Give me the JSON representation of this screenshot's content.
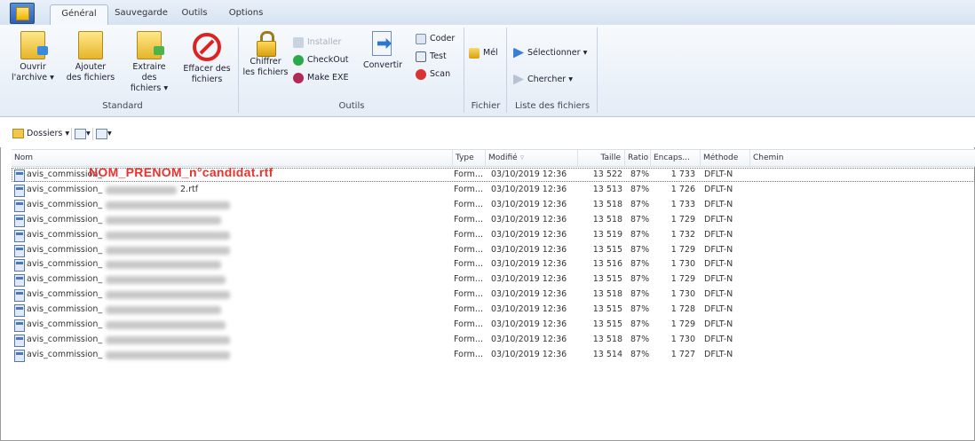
{
  "tabs": [
    "Général",
    "Sauvegarde",
    "Outils",
    "Options"
  ],
  "ribbon": {
    "standard": {
      "label": "Standard",
      "buttons": [
        {
          "line1": "Ouvrir",
          "line2": "l'archive ▾"
        },
        {
          "line1": "Ajouter",
          "line2": "des fichiers"
        },
        {
          "line1": "Extraire des",
          "line2": "fichiers ▾"
        },
        {
          "line1": "Effacer des",
          "line2": "fichiers"
        }
      ]
    },
    "outils": {
      "label": "Outils",
      "chiffrer": {
        "line1": "Chiffrer",
        "line2": "les fichiers"
      },
      "installer": "Installer",
      "checkout": "CheckOut",
      "make_exe": "Make EXE",
      "convertir": "Convertir",
      "coder": "Coder",
      "test": "Test",
      "scan": "Scan"
    },
    "fichier": {
      "label": "Fichier",
      "mel": "Mél"
    },
    "liste": {
      "label": "Liste des fichiers",
      "selectionner": "Sélectionner ▾",
      "chercher": "Chercher ▾"
    }
  },
  "toolbar": {
    "dossiers": "Dossiers ▾",
    "view1": "▾",
    "view2": "▾"
  },
  "columns": {
    "nom": "Nom",
    "type": "Type",
    "modifie": "Modifié",
    "taille": "Taille",
    "ratio": "Ratio",
    "encaps": "Encaps...",
    "methode": "Méthode",
    "chemin": "Chemin"
  },
  "first_row_overlay": "NOM_PRENOM_n°candidat.rtf",
  "rows": [
    {
      "name": "avis_commission_",
      "suffix": "",
      "type": "Form...",
      "modified": "03/10/2019 12:36",
      "size": "13 522",
      "ratio": "87%",
      "encaps": "1 733",
      "method": "DFLT-N"
    },
    {
      "name": "avis_commission_",
      "suffix": "2.rtf",
      "type": "Form...",
      "modified": "03/10/2019 12:36",
      "size": "13 513",
      "ratio": "87%",
      "encaps": "1 726",
      "method": "DFLT-N"
    },
    {
      "name": "avis_commission_",
      "suffix": "",
      "type": "Form...",
      "modified": "03/10/2019 12:36",
      "size": "13 518",
      "ratio": "87%",
      "encaps": "1 733",
      "method": "DFLT-N"
    },
    {
      "name": "avis_commission_",
      "suffix": "",
      "type": "Form...",
      "modified": "03/10/2019 12:36",
      "size": "13 518",
      "ratio": "87%",
      "encaps": "1 729",
      "method": "DFLT-N"
    },
    {
      "name": "avis_commission_",
      "suffix": "",
      "type": "Form...",
      "modified": "03/10/2019 12:36",
      "size": "13 519",
      "ratio": "87%",
      "encaps": "1 732",
      "method": "DFLT-N"
    },
    {
      "name": "avis_commission_",
      "suffix": "",
      "type": "Form...",
      "modified": "03/10/2019 12:36",
      "size": "13 515",
      "ratio": "87%",
      "encaps": "1 729",
      "method": "DFLT-N"
    },
    {
      "name": "avis_commission_",
      "suffix": "",
      "type": "Form...",
      "modified": "03/10/2019 12:36",
      "size": "13 516",
      "ratio": "87%",
      "encaps": "1 730",
      "method": "DFLT-N"
    },
    {
      "name": "avis_commission_",
      "suffix": "",
      "type": "Form...",
      "modified": "03/10/2019 12:36",
      "size": "13 515",
      "ratio": "87%",
      "encaps": "1 729",
      "method": "DFLT-N"
    },
    {
      "name": "avis_commission_",
      "suffix": "",
      "type": "Form...",
      "modified": "03/10/2019 12:36",
      "size": "13 518",
      "ratio": "87%",
      "encaps": "1 730",
      "method": "DFLT-N"
    },
    {
      "name": "avis_commission_",
      "suffix": "",
      "type": "Form...",
      "modified": "03/10/2019 12:36",
      "size": "13 515",
      "ratio": "87%",
      "encaps": "1 728",
      "method": "DFLT-N"
    },
    {
      "name": "avis_commission_",
      "suffix": "",
      "type": "Form...",
      "modified": "03/10/2019 12:36",
      "size": "13 515",
      "ratio": "87%",
      "encaps": "1 729",
      "method": "DFLT-N"
    },
    {
      "name": "avis_commission_",
      "suffix": "",
      "type": "Form...",
      "modified": "03/10/2019 12:36",
      "size": "13 518",
      "ratio": "87%",
      "encaps": "1 730",
      "method": "DFLT-N"
    },
    {
      "name": "avis_commission_",
      "suffix": "",
      "type": "Form...",
      "modified": "03/10/2019 12:36",
      "size": "13 514",
      "ratio": "87%",
      "encaps": "1 727",
      "method": "DFLT-N"
    }
  ]
}
